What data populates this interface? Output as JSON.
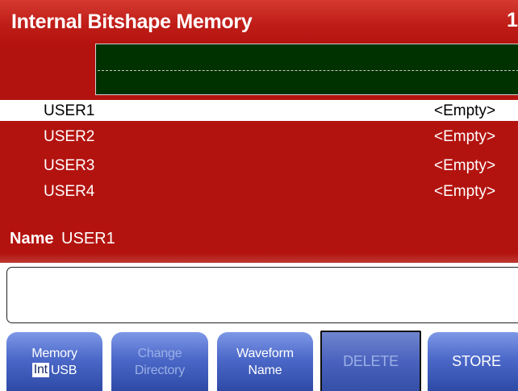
{
  "header": {
    "title": "Internal Bitshape Memory",
    "channel": "1"
  },
  "memory_list": [
    {
      "name": "USER1",
      "status": "<Empty>",
      "selected": true
    },
    {
      "name": "USER2",
      "status": "<Empty>",
      "selected": false
    },
    {
      "name": "USER3",
      "status": "<Empty>",
      "selected": false
    },
    {
      "name": "USER4",
      "status": "<Empty>",
      "selected": false
    }
  ],
  "name_field": {
    "label": "Name",
    "value": "USER1"
  },
  "softkeys": {
    "memory": {
      "label": "Memory",
      "option_int": "Int",
      "option_usb": "USB",
      "selected": "Int"
    },
    "change_directory": {
      "line1": "Change",
      "line2": "Directory",
      "enabled": false
    },
    "waveform_name": {
      "line1": "Waveform",
      "line2": "Name"
    },
    "delete": {
      "label": "DELETE",
      "enabled": false
    },
    "store": {
      "label": "STORE"
    }
  },
  "colors": {
    "background": "#b3130f",
    "preview_background": "#003200",
    "softkey": "#4c69c9"
  }
}
